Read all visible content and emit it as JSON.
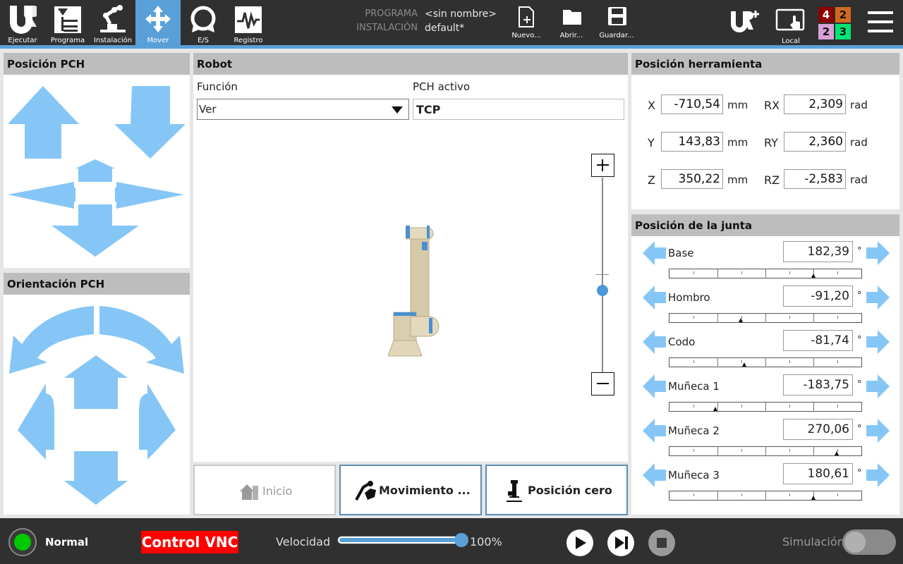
{
  "topbar": {
    "nav": [
      {
        "label": "Ejecutar",
        "icon": "ur-logo-icon",
        "active": false
      },
      {
        "label": "Programa",
        "icon": "program-icon",
        "active": false
      },
      {
        "label": "Instalación",
        "icon": "installation-icon",
        "active": false
      },
      {
        "label": "Mover",
        "icon": "move-icon",
        "active": true
      },
      {
        "label": "E/S",
        "icon": "io-icon",
        "active": false
      },
      {
        "label": "Registro",
        "icon": "log-icon",
        "active": false
      }
    ],
    "program_label": "PROGRAMA",
    "program_value": "<sin nombre>",
    "installation_label": "INSTALACIÓN",
    "installation_value": "default*",
    "file_buttons": [
      {
        "label": "Nuevo...",
        "icon": "new-file-icon"
      },
      {
        "label": "Abrir...",
        "icon": "open-folder-icon"
      },
      {
        "label": "Guardar...",
        "icon": "save-icon"
      }
    ],
    "local_label": "Local",
    "badges": [
      {
        "value": "4",
        "color": "#8b0000",
        "text_color": "#ffffff"
      },
      {
        "value": "2",
        "color": "#d2691e",
        "text_color": "#111111"
      },
      {
        "value": "2",
        "color": "#d8a0d8",
        "text_color": "#111111"
      },
      {
        "value": "3",
        "color": "#00e676",
        "text_color": "#111111"
      }
    ]
  },
  "tcp_position": {
    "title": "Posición PCH"
  },
  "tcp_orientation": {
    "title": "Orientación PCH"
  },
  "robot": {
    "title": "Robot",
    "function_label": "Función",
    "function_value": "Ver",
    "active_tcp_label": "PCH activo",
    "active_tcp_value": "TCP",
    "zoom_level": 0.42,
    "buttons": {
      "home": "Inicio",
      "freedrive": "Movimiento ...",
      "zero": "Posición cero"
    }
  },
  "tool_position": {
    "title": "Posición herramienta",
    "rows": [
      {
        "axis": "X",
        "value": "-710,54",
        "unit": "mm",
        "raxis": "RX",
        "rvalue": "2,309",
        "runit": "rad"
      },
      {
        "axis": "Y",
        "value": "143,83",
        "unit": "mm",
        "raxis": "RY",
        "rvalue": "2,360",
        "runit": "rad"
      },
      {
        "axis": "Z",
        "value": "350,22",
        "unit": "mm",
        "raxis": "RZ",
        "rvalue": "-2,583",
        "runit": "rad"
      }
    ]
  },
  "joint_position": {
    "title": "Posición de la junta",
    "unit": "°",
    "joints": [
      {
        "name": "Base",
        "value": "182,39",
        "level": 0.75
      },
      {
        "name": "Hombro",
        "value": "-91,20",
        "level": 0.37
      },
      {
        "name": "Codo",
        "value": "-81,74",
        "level": 0.39
      },
      {
        "name": "Muñeca 1",
        "value": "-183,75",
        "level": 0.24
      },
      {
        "name": "Muñeca 2",
        "value": "270,06",
        "level": 0.87
      },
      {
        "name": "Muñeca 3",
        "value": "180,61",
        "level": 0.75
      }
    ]
  },
  "bottombar": {
    "status": "Normal",
    "status_color": "#00c800",
    "vnc_label": "Control VNC",
    "vnc_color": "#ff0000",
    "speed_label": "Velocidad",
    "speed_value": "100%",
    "speed_level": 1.0,
    "simulation_label": "Simulación"
  }
}
